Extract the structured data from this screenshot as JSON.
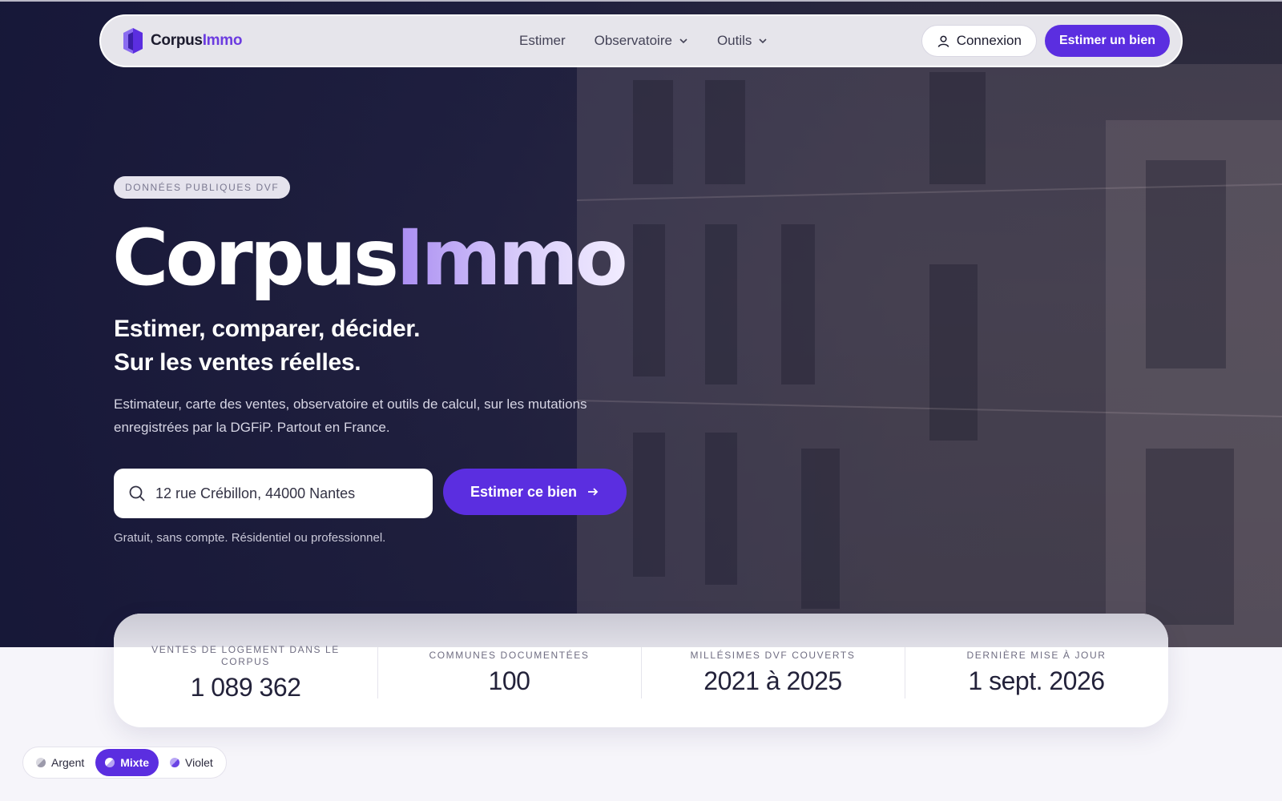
{
  "brand": {
    "name_main": "Corpus",
    "name_accent": "Immo"
  },
  "nav": {
    "links": [
      {
        "label": "Estimer"
      },
      {
        "label": "Observatoire"
      },
      {
        "label": "Outils"
      }
    ],
    "login_label": "Connexion",
    "cta_label": "Estimer un bien"
  },
  "hero": {
    "badge": "DONNÉES PUBLIQUES DVF",
    "title_main": "Corpus",
    "title_accent": "Immo",
    "subtitle_line1": "Estimer, comparer, décider.",
    "subtitle_line2": "Sur les ventes réelles.",
    "description": "Estimateur, carte des ventes, observatoire et outils de calcul, sur les mutations enregistrées par la DGFiP. Partout en France.",
    "search_value": "12 rue Crébillon, 44000 Nantes",
    "search_button": "Estimer ce bien",
    "note": "Gratuit, sans compte. Résidentiel ou professionnel."
  },
  "stats": [
    {
      "label": "VENTES DE LOGEMENT DANS LE CORPUS",
      "value": "1 089 362"
    },
    {
      "label": "COMMUNES DOCUMENTÉES",
      "value": "100"
    },
    {
      "label": "MILLÉSIMES DVF COUVERTS",
      "value": "2021 à 2025"
    },
    {
      "label": "DERNIÈRE MISE À JOUR",
      "value": "1 sept. 2026"
    }
  ],
  "theme": {
    "options": [
      {
        "label": "Argent",
        "active": false
      },
      {
        "label": "Mixte",
        "active": true
      },
      {
        "label": "Violet",
        "active": false
      }
    ]
  },
  "colors": {
    "accent": "#5b2ee0",
    "hero_dark": "#1a1b3e",
    "text_dark": "#23223a"
  }
}
